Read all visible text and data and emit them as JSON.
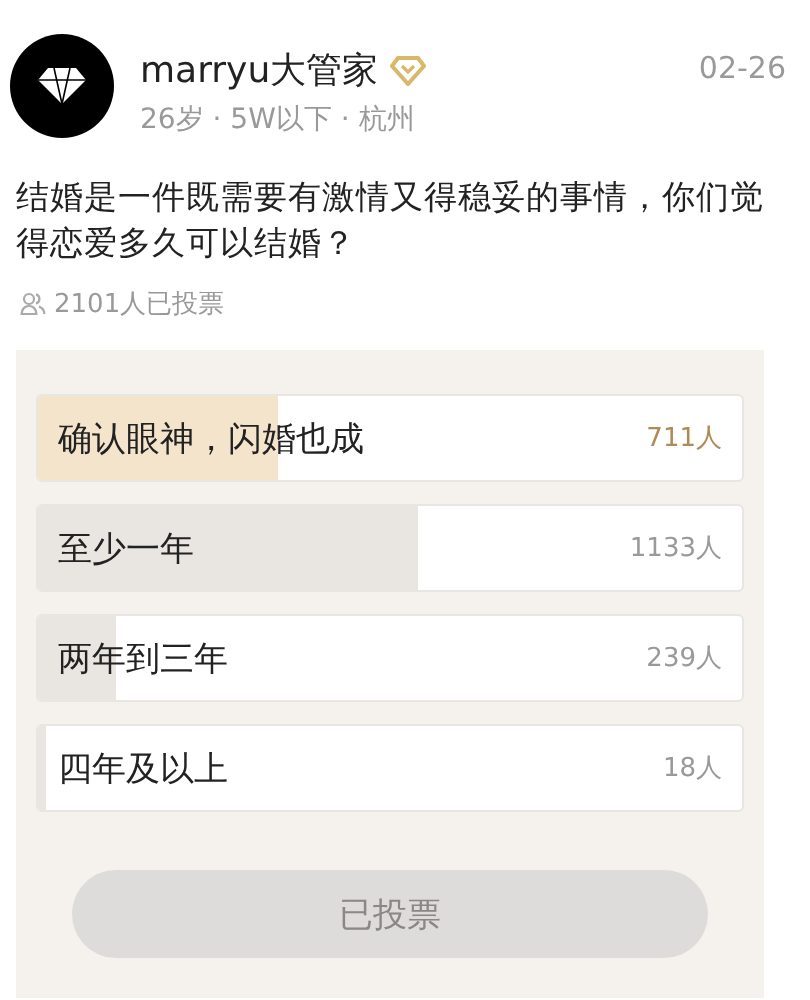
{
  "post": {
    "author": "marryu大管家",
    "verified": true,
    "meta": "26岁 · 5W以下 · 杭州",
    "date": "02-26",
    "question": "结婚是一件既需要有激情又得稳妥的事情，你们觉得恋爱多久可以结婚？",
    "vote_count": "2101人已投票"
  },
  "poll": {
    "options": [
      {
        "label": "确认眼神，闪婚也成",
        "count": "711人",
        "level": 0.34,
        "selected": true
      },
      {
        "label": "至少一年",
        "count": "1133人",
        "level": 0.54,
        "selected": false
      },
      {
        "label": "两年到三年",
        "count": "239人",
        "level": 0.11,
        "selected": false
      },
      {
        "label": "四年及以上",
        "count": "18人",
        "level": 0.01,
        "selected": false
      }
    ],
    "button": {
      "label": "已投票",
      "disabled": true
    }
  }
}
